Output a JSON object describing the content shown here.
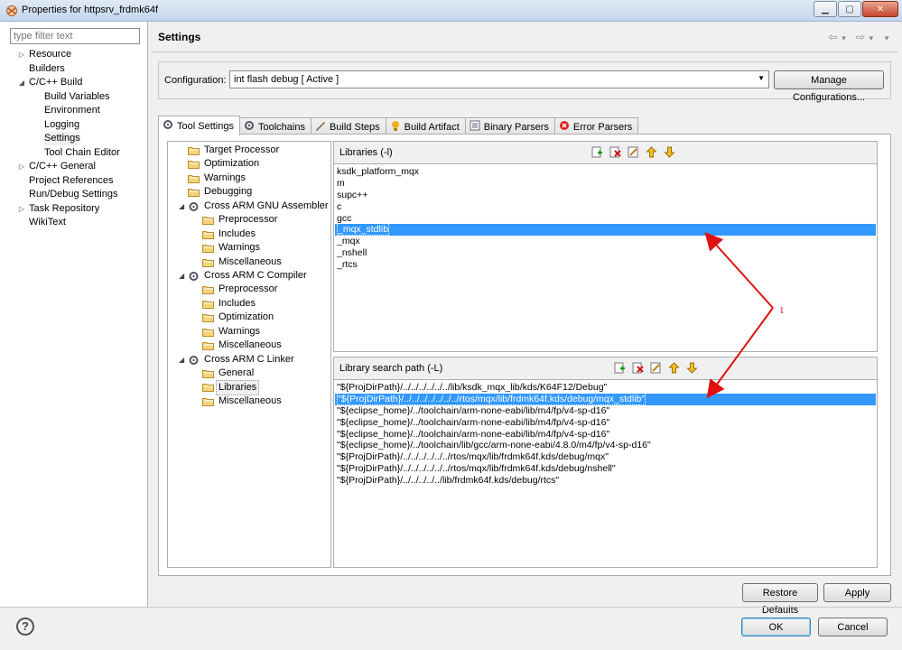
{
  "window": {
    "title": "Properties for httpsrv_frdmk64f"
  },
  "filter": {
    "placeholder": "type filter text"
  },
  "nav": {
    "items": [
      {
        "label": "Resource",
        "expander": "▷"
      },
      {
        "label": "Builders",
        "expander": ""
      },
      {
        "label": "C/C++ Build",
        "expander": "◢"
      },
      {
        "label": "Build Variables",
        "expander": ""
      },
      {
        "label": "Environment",
        "expander": ""
      },
      {
        "label": "Logging",
        "expander": ""
      },
      {
        "label": "Settings",
        "expander": ""
      },
      {
        "label": "Tool Chain Editor",
        "expander": ""
      },
      {
        "label": "C/C++ General",
        "expander": "▷"
      },
      {
        "label": "Project References",
        "expander": ""
      },
      {
        "label": "Run/Debug Settings",
        "expander": ""
      },
      {
        "label": "Task Repository",
        "expander": "▷"
      },
      {
        "label": "WikiText",
        "expander": ""
      }
    ]
  },
  "header": {
    "title": "Settings"
  },
  "configuration": {
    "label": "Configuration:",
    "value": "int flash debug  [ Active ]",
    "manage_label": "Manage Configurations..."
  },
  "tabs": [
    {
      "label": "Tool Settings",
      "icon": "tool-settings-icon"
    },
    {
      "label": "Toolchains",
      "icon": "toolchains-icon"
    },
    {
      "label": "Build Steps",
      "icon": "build-steps-icon"
    },
    {
      "label": "Build Artifact",
      "icon": "build-artifact-icon"
    },
    {
      "label": "Binary Parsers",
      "icon": "binary-parsers-icon"
    },
    {
      "label": "Error Parsers",
      "icon": "error-parsers-icon"
    }
  ],
  "tool_tree": [
    {
      "label": "Target Processor",
      "level": 0
    },
    {
      "label": "Optimization",
      "level": 0
    },
    {
      "label": "Warnings",
      "level": 0
    },
    {
      "label": "Debugging",
      "level": 0
    },
    {
      "label": "Cross ARM GNU Assembler",
      "level": 0,
      "tool": true
    },
    {
      "label": "Preprocessor",
      "level": 1
    },
    {
      "label": "Includes",
      "level": 1
    },
    {
      "label": "Warnings",
      "level": 1
    },
    {
      "label": "Miscellaneous",
      "level": 1
    },
    {
      "label": "Cross ARM C Compiler",
      "level": 0,
      "tool": true
    },
    {
      "label": "Preprocessor",
      "level": 1
    },
    {
      "label": "Includes",
      "level": 1
    },
    {
      "label": "Optimization",
      "level": 1
    },
    {
      "label": "Warnings",
      "level": 1
    },
    {
      "label": "Miscellaneous",
      "level": 1
    },
    {
      "label": "Cross ARM C Linker",
      "level": 0,
      "tool": true
    },
    {
      "label": "General",
      "level": 1
    },
    {
      "label": "Libraries",
      "level": 1,
      "selected": true
    },
    {
      "label": "Miscellaneous",
      "level": 1
    }
  ],
  "libraries": {
    "title": "Libraries (-l)",
    "items": [
      "ksdk_platform_mqx",
      "m",
      "supc++",
      "c",
      "gcc",
      "_mqx_stdlib",
      "_mqx",
      "_nshell",
      "_rtcs"
    ],
    "selected_index": 5
  },
  "library_paths": {
    "title": "Library search path (-L)",
    "items": [
      "\"${ProjDirPath}/../../../../../../lib/ksdk_mqx_lib/kds/K64F12/Debug\"",
      "\"${ProjDirPath}/../../../../../../../rtos/mqx/lib/frdmk64f.kds/debug/mqx_stdlib\"",
      "\"${eclipse_home}/../toolchain/arm-none-eabi/lib/m4/fp/v4-sp-d16\"",
      "\"${eclipse_home}/../toolchain/arm-none-eabi/lib/m4/fp/v4-sp-d16\"",
      "\"${eclipse_home}/../toolchain/arm-none-eabi/lib/m4/fp/v4-sp-d16\"",
      "\"${eclipse_home}/../toolchain/lib/gcc/arm-none-eabi/4.8.0/m4/fp/v4-sp-d16\"",
      "\"${ProjDirPath}/../../../../../../rtos/mqx/lib/frdmk64f.kds/debug/mqx\"",
      "\"${ProjDirPath}/../../../../../../rtos/mqx/lib/frdmk64f.kds/debug/nshell\"",
      "\"${ProjDirPath}/../../../../../lib/frdmk64f.kds/debug/rtcs\""
    ],
    "selected_index": 1
  },
  "annotation": {
    "label": "1",
    "color": "#e01010"
  },
  "buttons": {
    "restore": "Restore Defaults",
    "apply": "Apply",
    "ok": "OK",
    "cancel": "Cancel"
  },
  "help": {
    "glyph": "?"
  },
  "colors": {
    "selection": "#3399ff",
    "arrow": "#e01010"
  }
}
